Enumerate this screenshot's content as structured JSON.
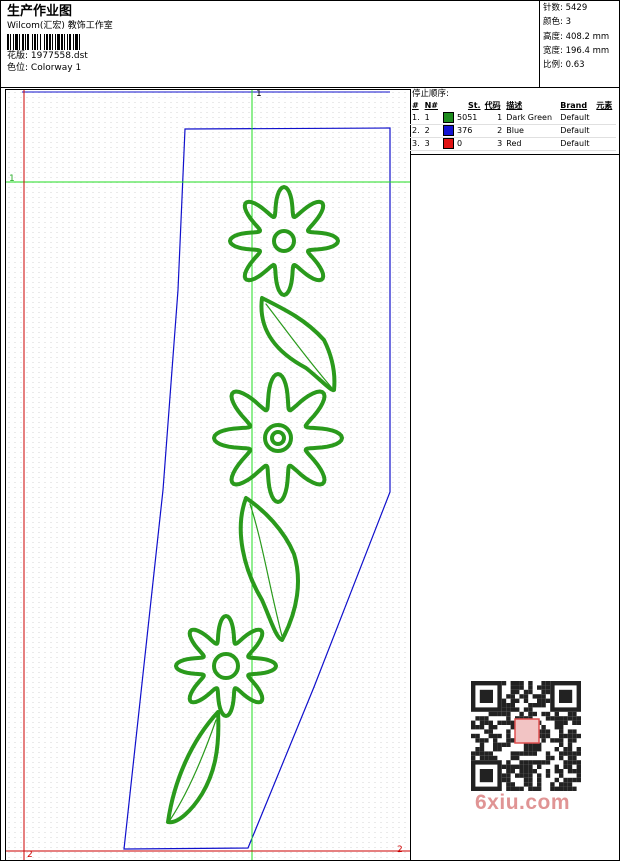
{
  "header": {
    "title": "生产作业图",
    "company": "Wilcom(汇宏) 教饰工作室",
    "design_label": "花版:",
    "design_value": "1977558.dst",
    "colorway_label": "色位:",
    "colorway_value": "Colorway 1"
  },
  "stats": [
    {
      "label": "针数",
      "value": "5429"
    },
    {
      "label": "颜色",
      "value": "3"
    },
    {
      "label": "高度",
      "value": "408.2 mm"
    },
    {
      "label": "宽度",
      "value": "196.4 mm"
    },
    {
      "label": "比例",
      "value": "0.63"
    }
  ],
  "stop_sequence": {
    "title": "停止顺序:",
    "columns": [
      "#",
      "N#",
      "St.",
      "代码",
      "描述",
      "Brand",
      "元素"
    ],
    "rows": [
      {
        "idx": "1.",
        "n": "1",
        "color": "#1e8c1e",
        "stitches": "5051",
        "code": "1",
        "desc": "Dark Green",
        "brand": "Default"
      },
      {
        "idx": "2.",
        "n": "2",
        "color": "#1414d2",
        "stitches": "376",
        "code": "2",
        "desc": "Blue",
        "brand": "Default"
      },
      {
        "idx": "3.",
        "n": "3",
        "color": "#e01414",
        "stitches": "0",
        "code": "3",
        "desc": "Red",
        "brand": "Default"
      }
    ]
  },
  "canvas": {
    "guide_labels": {
      "top": "1",
      "left": "1",
      "bottom_left": "2",
      "bottom_right": "2"
    },
    "colors": {
      "embroidery": "#2a9a1c",
      "outline": "#1010cc",
      "guide_green": "#22dd22",
      "guide_red": "#cc0000"
    }
  },
  "watermark": "6xiu.com"
}
